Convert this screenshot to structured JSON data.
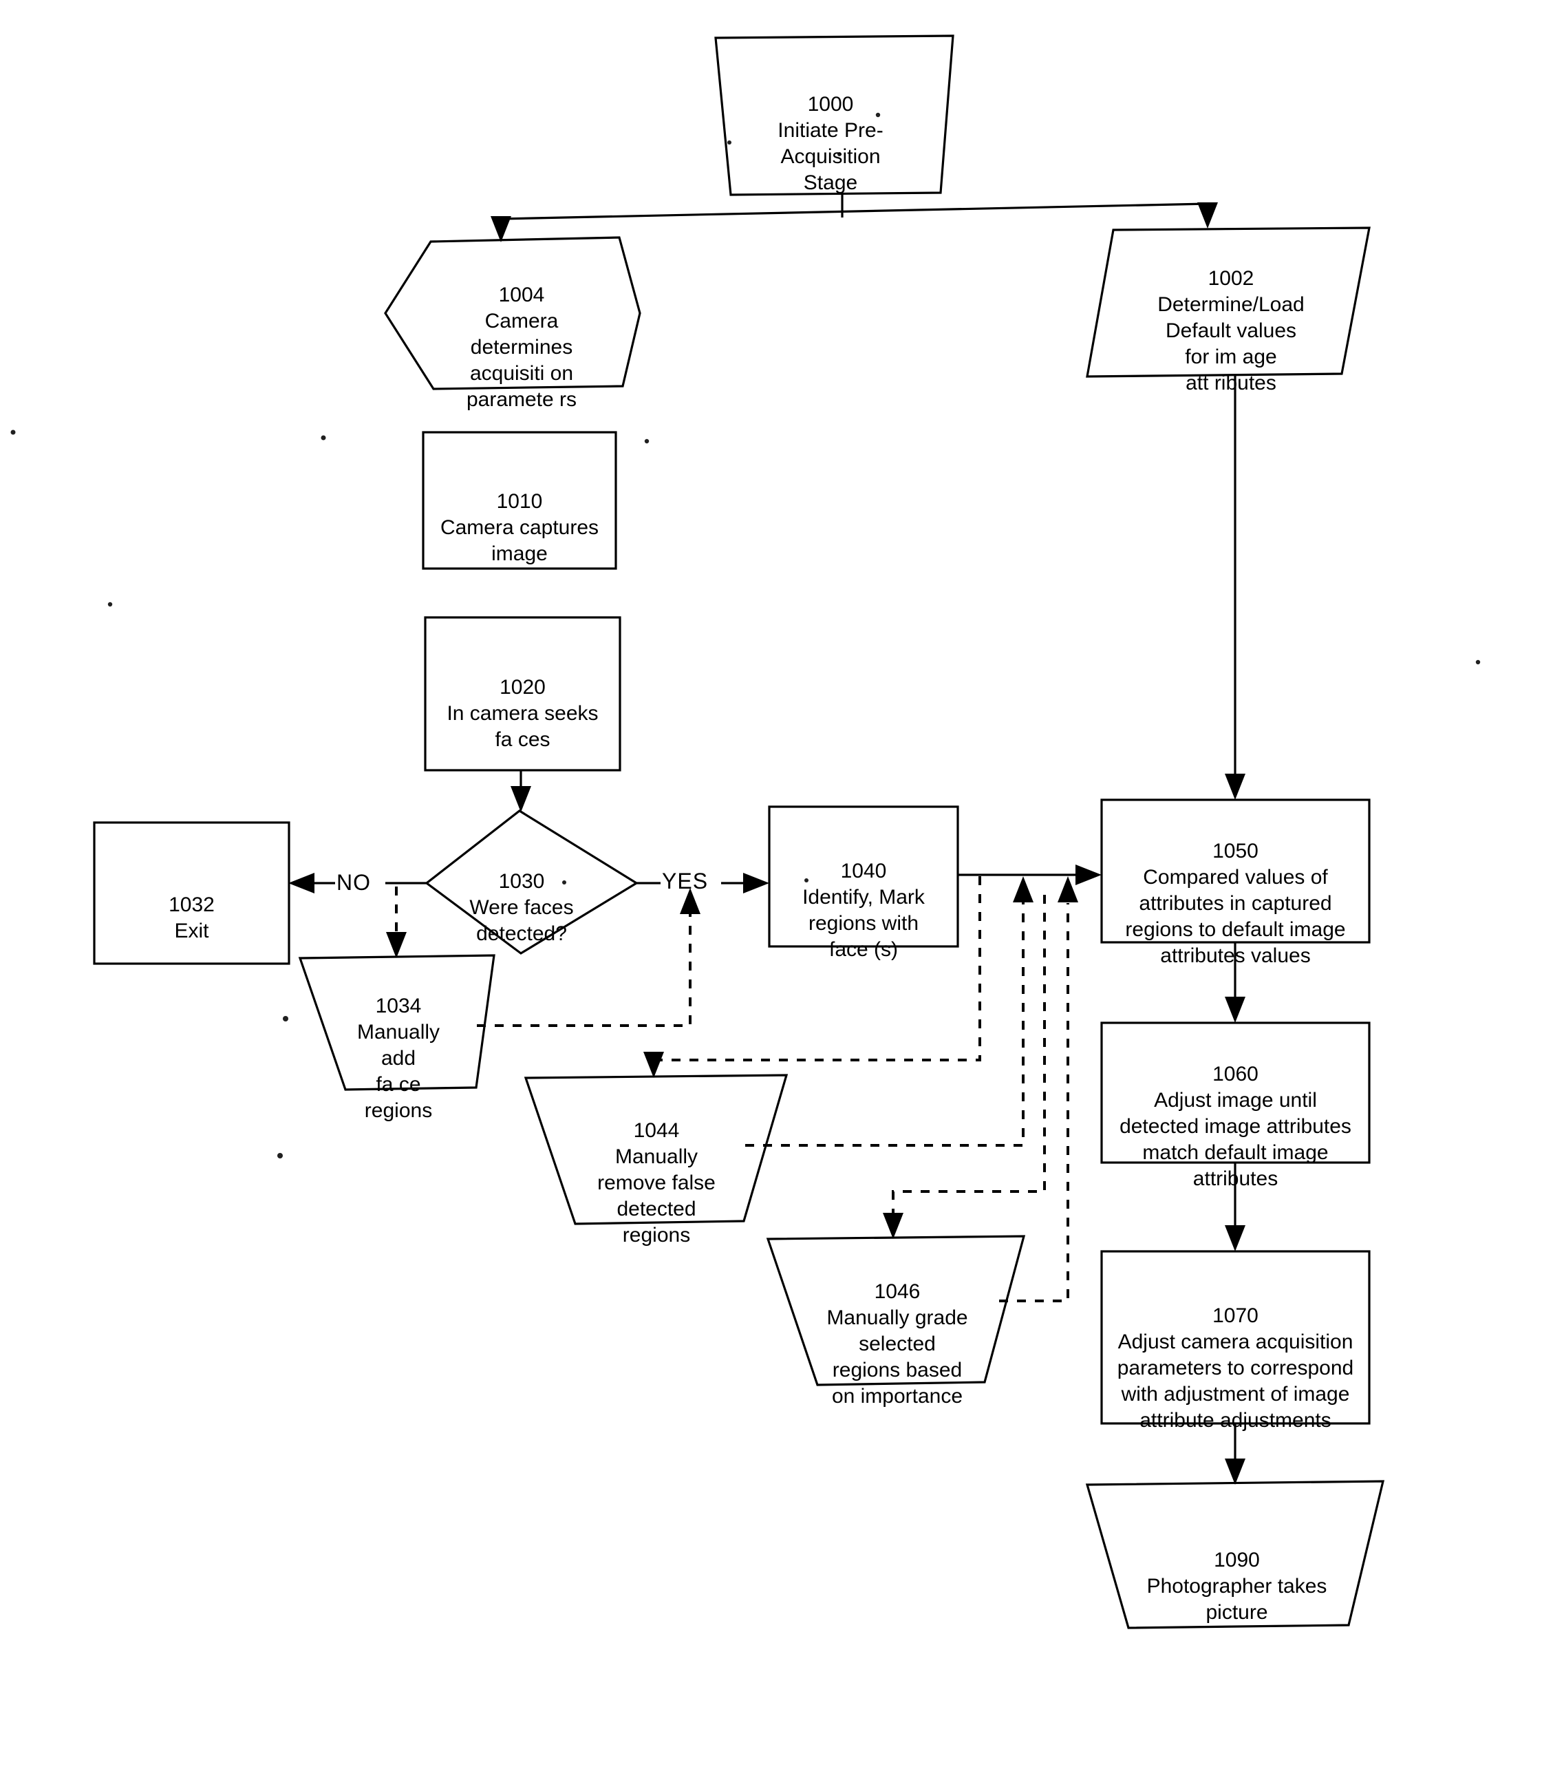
{
  "document": {
    "type": "patent-flowchart",
    "background_color": "#ffffff",
    "line_color": "#000000"
  },
  "nodes": [
    {
      "id": "1000",
      "shape": "trapezoid-down",
      "number": "1000",
      "text": "Initiate Pre-\nAcquisition\nStage"
    },
    {
      "id": "1004",
      "shape": "hexagon",
      "number": "1004",
      "text": "Camera\ndetermines\nacquisiti on\nparamete  rs"
    },
    {
      "id": "1002",
      "shape": "parallelogram",
      "number": "1002",
      "text": "Determine/Load\nDefault values\nfor  im age\natt ributes"
    },
    {
      "id": "1010",
      "shape": "rectangle",
      "number": "1010",
      "text": "Camera captures\nimage"
    },
    {
      "id": "1020",
      "shape": "rectangle",
      "number": "1020",
      "text": "In camera seeks\nfa ces"
    },
    {
      "id": "1030",
      "shape": "diamond",
      "number": "1030",
      "text": "Were faces\ndetected?"
    },
    {
      "id": "1032",
      "shape": "rectangle",
      "number": "1032",
      "text": "Exit"
    },
    {
      "id": "1034",
      "shape": "trapezoid-down",
      "number": "1034",
      "text": "Manually\nadd\nfa ce\nregions"
    },
    {
      "id": "1040",
      "shape": "rectangle",
      "number": "1040",
      "text": "Identify, Mark\nregions with\nface (s)"
    },
    {
      "id": "1044",
      "shape": "trapezoid-down",
      "number": "1044",
      "text": "Manually\nremove false\ndetected\nregions"
    },
    {
      "id": "1046",
      "shape": "trapezoid-down",
      "number": "1046",
      "text": "Manually grade\nselected\nregions based\non importance"
    },
    {
      "id": "1050",
      "shape": "rectangle",
      "number": "1050",
      "text": "Compared values of\nattributes in captured\nregions to default image\nattributes values"
    },
    {
      "id": "1060",
      "shape": "rectangle",
      "number": "1060",
      "text": "Adjust image until\ndetected image attributes\nmatch  default image\nattributes"
    },
    {
      "id": "1070",
      "shape": "rectangle",
      "number": "1070",
      "text": "Adjust camera acquisition\nparameters to correspond\nwith  adjustment of image\nattribute adjustments"
    },
    {
      "id": "1090",
      "shape": "trapezoid-down",
      "number": "1090",
      "text": "Photographer takes\npicture"
    }
  ],
  "edge_labels": {
    "no": "NO",
    "yes": "YES"
  },
  "connections": [
    {
      "from": "1000",
      "to": "1004",
      "style": "solid"
    },
    {
      "from": "1000",
      "to": "1002",
      "style": "solid"
    },
    {
      "from": "1020",
      "to": "1030",
      "style": "solid"
    },
    {
      "from": "1030",
      "to": "1032",
      "style": "solid",
      "label": "NO"
    },
    {
      "from": "1030",
      "to": "1040",
      "style": "solid",
      "label": "YES"
    },
    {
      "from": "1030",
      "to": "1034",
      "style": "dashed"
    },
    {
      "from": "1034",
      "to": "1030-yes-branch",
      "style": "dashed"
    },
    {
      "from": "1040",
      "to": "1050",
      "style": "solid"
    },
    {
      "from": "1040",
      "to": "1044",
      "style": "dashed"
    },
    {
      "from": "1044",
      "to": "1050-feed",
      "style": "dashed"
    },
    {
      "from": "1044",
      "to": "1046",
      "style": "dashed"
    },
    {
      "from": "1046",
      "to": "1050-feed",
      "style": "dashed"
    },
    {
      "from": "1002",
      "to": "1050",
      "style": "solid"
    },
    {
      "from": "1050",
      "to": "1060",
      "style": "solid"
    },
    {
      "from": "1060",
      "to": "1070",
      "style": "solid"
    },
    {
      "from": "1070",
      "to": "1090",
      "style": "solid"
    }
  ]
}
